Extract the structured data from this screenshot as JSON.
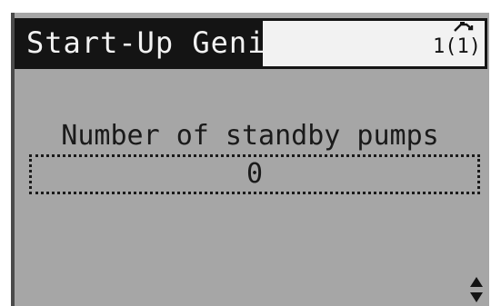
{
  "header": {
    "title": "Start-Up Genie",
    "menu_index": "1(1)",
    "menu_icon": "menu-tree-icon"
  },
  "parameter": {
    "label": "Number of standby pumps",
    "value": "0"
  },
  "scroll": {
    "icon": "up-down-arrows-icon"
  }
}
